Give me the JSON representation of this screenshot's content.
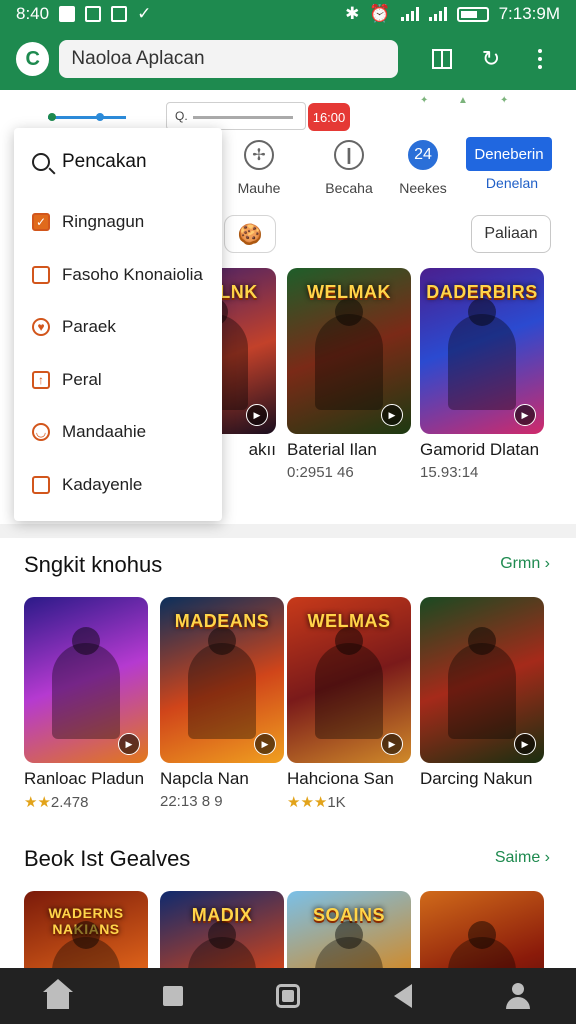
{
  "status_bar": {
    "time": "8:40",
    "right_time": "7:13:9M"
  },
  "app_bar": {
    "logo_glyph": "C",
    "search_text": "Naoloa Aplacan"
  },
  "toolbar": {
    "badge": "16:00"
  },
  "categories": [
    {
      "label": "Mauhe",
      "icon": "compass-icon"
    },
    {
      "label": "Becaha",
      "icon": "info-icon"
    },
    {
      "label": "Neekes",
      "icon": "chat-icon"
    },
    {
      "label": "Denelan",
      "icon": "download-icon"
    }
  ],
  "blue_button": "Deneberin",
  "outline_button": "Paliaan",
  "menu": {
    "title": "Pencakan",
    "items": [
      {
        "label": "Ringnagun",
        "icon": "checkbox-icon"
      },
      {
        "label": "Fasoho Knonaiolia",
        "icon": "edit-icon"
      },
      {
        "label": "Paraek",
        "icon": "shield-icon"
      },
      {
        "label": "Peral",
        "icon": "share-icon"
      },
      {
        "label": "Mandaahie",
        "icon": "clock-icon"
      },
      {
        "label": "Kadayenle",
        "icon": "note-icon"
      }
    ]
  },
  "top_row": [
    {
      "title": "WEIDLNK",
      "name": "",
      "sub": "",
      "partial_name": "akıı"
    },
    {
      "title": "WELMAK",
      "name": "Baterial Ilan",
      "sub": "0:2951 46"
    },
    {
      "title": "DADERBIRS",
      "name": "Gamorid Dlatan",
      "sub": "15.93:14"
    }
  ],
  "sections": [
    {
      "title": "Sngkit knohus",
      "link": "Grmn",
      "cards": [
        {
          "title": "",
          "name": "Ranloac Pladun",
          "stars": "★★",
          "sub": "2.478"
        },
        {
          "title": "MADEANS",
          "name": "Napcla Nan",
          "stars": "",
          "sub": "22:13 8 9"
        },
        {
          "title": "WELMAS",
          "name": "Hahciona San",
          "stars": "★★★",
          "sub": "1K"
        },
        {
          "title": "",
          "name": "Darcing Nakun",
          "stars": "",
          "sub": ""
        }
      ]
    },
    {
      "title": "Beok Ist Gealves",
      "link": "Saime",
      "cards": [
        {
          "title": "WADERNS NAKIANS"
        },
        {
          "title": "MADIX"
        },
        {
          "title": "SOAINS"
        },
        {
          "title": ""
        }
      ]
    }
  ],
  "nav": [
    "home-icon",
    "search-icon",
    "overview-icon",
    "back-icon",
    "profile-icon"
  ]
}
